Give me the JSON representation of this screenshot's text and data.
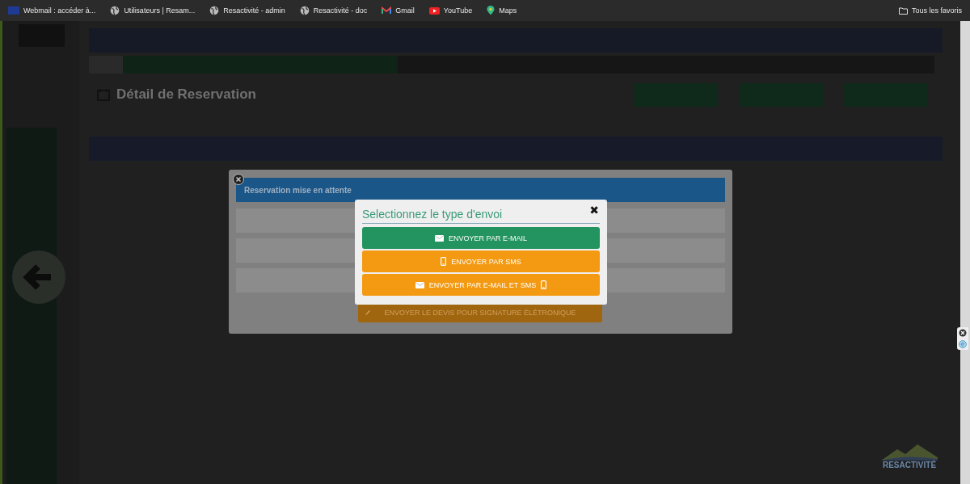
{
  "bookmarks_bar": {
    "items": [
      {
        "label": "Webmail : accéder à...",
        "kind": "flag"
      },
      {
        "label": "Utilisateurs | Resam...",
        "kind": "globe"
      },
      {
        "label": "Resactivité - admin",
        "kind": "globe"
      },
      {
        "label": "Resactivité - doc",
        "kind": "globe"
      },
      {
        "label": "Gmail",
        "kind": "gmail"
      },
      {
        "label": "YouTube",
        "kind": "youtube"
      },
      {
        "label": "Maps",
        "kind": "maps"
      }
    ],
    "all_bookmarks": "Tous les favoris"
  },
  "page": {
    "title": "Détail de Reservation",
    "logo": "RESACTIVITÉ"
  },
  "status_modal": {
    "banner": "Reservation mise en attente",
    "signature_button": "ENVOYER LE DEVIS POUR SIGNATURE ÉLÉTRONIQUE"
  },
  "send_dialog": {
    "title": "Selectionnez le type d'envoi",
    "close": "✖",
    "options": [
      {
        "label": "ENVOYER PAR E-MAIL",
        "kind": "email",
        "color": "#23945f"
      },
      {
        "label": "ENVOYER PAR SMS",
        "kind": "sms",
        "color": "#f39a12"
      },
      {
        "label": "ENVOYER PAR E-MAIL ET SMS",
        "kind": "both",
        "color": "#f39a12"
      }
    ]
  }
}
